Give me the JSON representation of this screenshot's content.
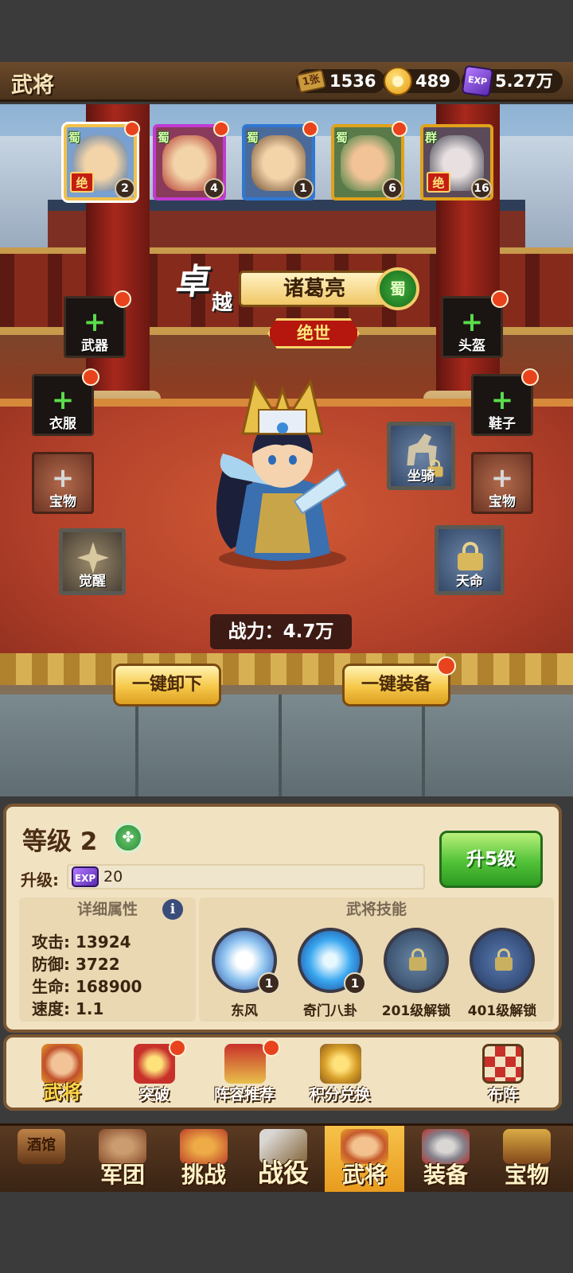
{
  "topbar": {
    "title": "武将",
    "resources": [
      {
        "icon": "ticket-icon",
        "glyph": "1张",
        "value": "1536"
      },
      {
        "icon": "coin-icon",
        "glyph": "●",
        "value": "489"
      },
      {
        "icon": "exp-icon",
        "glyph": "EXP",
        "value": "5.27万"
      }
    ]
  },
  "heroes": [
    {
      "faction": "蜀",
      "level": "2",
      "tag": "绝",
      "border": "#f2c14a",
      "face": "#3d6fa8",
      "selected": true
    },
    {
      "faction": "蜀",
      "level": "4",
      "tag": "",
      "border": "#c13bd1",
      "face": "#b0322a",
      "selected": false
    },
    {
      "faction": "蜀",
      "level": "1",
      "tag": "",
      "border": "#2f78d4",
      "face": "#6a4a30",
      "selected": false
    },
    {
      "faction": "蜀",
      "level": "6",
      "tag": "",
      "border": "#e0a21a",
      "face": "#2f7a3a",
      "selected": false
    },
    {
      "faction": "群",
      "level": "16",
      "tag": "绝",
      "border": "#e0a21a",
      "face": "#3a3a4a",
      "selected": false
    }
  ],
  "hero": {
    "prefix_top": "卓",
    "prefix_bottom": "越",
    "name": "诸葛亮",
    "faction": "蜀",
    "rarity": "绝世"
  },
  "slots": {
    "weapon": "武器",
    "clothes": "衣服",
    "treasure_left": "宝物",
    "awaken": "觉醒",
    "helmet": "头盔",
    "shoes": "鞋子",
    "mount": "坐骑",
    "treasure_right": "宝物",
    "destiny": "天命"
  },
  "power": "战力：4.7万",
  "buttons": {
    "unequip_all": "一键卸下",
    "equip_all": "一键装备",
    "level_up": "升5级"
  },
  "level": {
    "title": "等级 2",
    "upgrade_label": "升级:",
    "exp_icon": "EXP",
    "exp_cost": "20"
  },
  "attributes": {
    "header": "详细属性",
    "info_glyph": "i",
    "items": [
      "攻击: 13924",
      "防御: 3722",
      "生命: 168900",
      "速度: 1.1"
    ]
  },
  "skills": {
    "header": "武将技能",
    "items": [
      {
        "name": "东风",
        "badge": "1",
        "locked": false
      },
      {
        "name": "奇门八卦",
        "badge": "1",
        "locked": false
      },
      {
        "name": "201级解锁",
        "badge": "",
        "locked": true
      },
      {
        "name": "401级解锁",
        "badge": "",
        "locked": true
      }
    ]
  },
  "subtabs": [
    {
      "label": "武将",
      "dot": false,
      "active": true
    },
    {
      "label": "突破",
      "dot": true,
      "active": false
    },
    {
      "label": "阵容推荐",
      "dot": true,
      "active": false
    },
    {
      "label": "积分兑换",
      "dot": false,
      "active": false
    },
    {
      "label": "布阵",
      "dot": false,
      "active": false
    }
  ],
  "nav": [
    {
      "label": "酒馆",
      "active": false
    },
    {
      "label": "军团",
      "active": false
    },
    {
      "label": "挑战",
      "active": false
    },
    {
      "label": "战役",
      "active": false
    },
    {
      "label": "武将",
      "active": true
    },
    {
      "label": "装备",
      "active": false
    },
    {
      "label": "宝物",
      "active": false
    }
  ]
}
